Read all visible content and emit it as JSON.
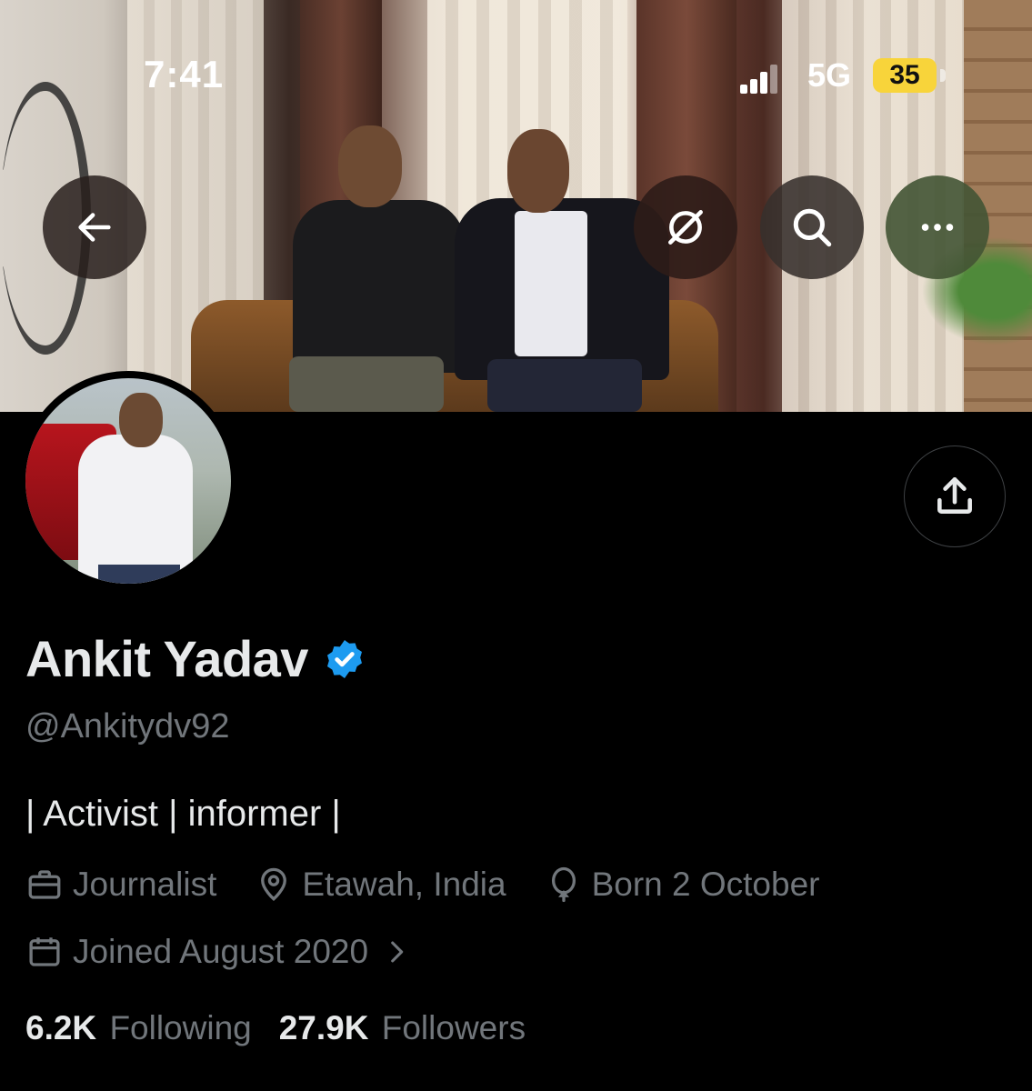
{
  "status_bar": {
    "time": "7:41",
    "network": "5G",
    "battery": "35"
  },
  "profile": {
    "name": "Ankit Yadav",
    "handle": "@Ankitydv92",
    "bio": "| Activist | informer |",
    "job": "Journalist",
    "location": "Etawah, India",
    "birthday": "Born 2 October",
    "joined": "Joined August 2020",
    "following_count": "6.2K",
    "following_label": "Following",
    "followers_count": "27.9K",
    "followers_label": "Followers"
  },
  "colors": {
    "background": "#000000",
    "primary_text": "#e7e9ea",
    "secondary_text": "#71767b",
    "verified": "#1d9bf0",
    "battery": "#f8d43a"
  },
  "icons": [
    "back-arrow-icon",
    "grok-icon",
    "search-icon",
    "more-icon",
    "share-icon",
    "verified-badge-icon",
    "briefcase-icon",
    "location-pin-icon",
    "balloon-icon",
    "calendar-icon",
    "chevron-right-icon"
  ]
}
